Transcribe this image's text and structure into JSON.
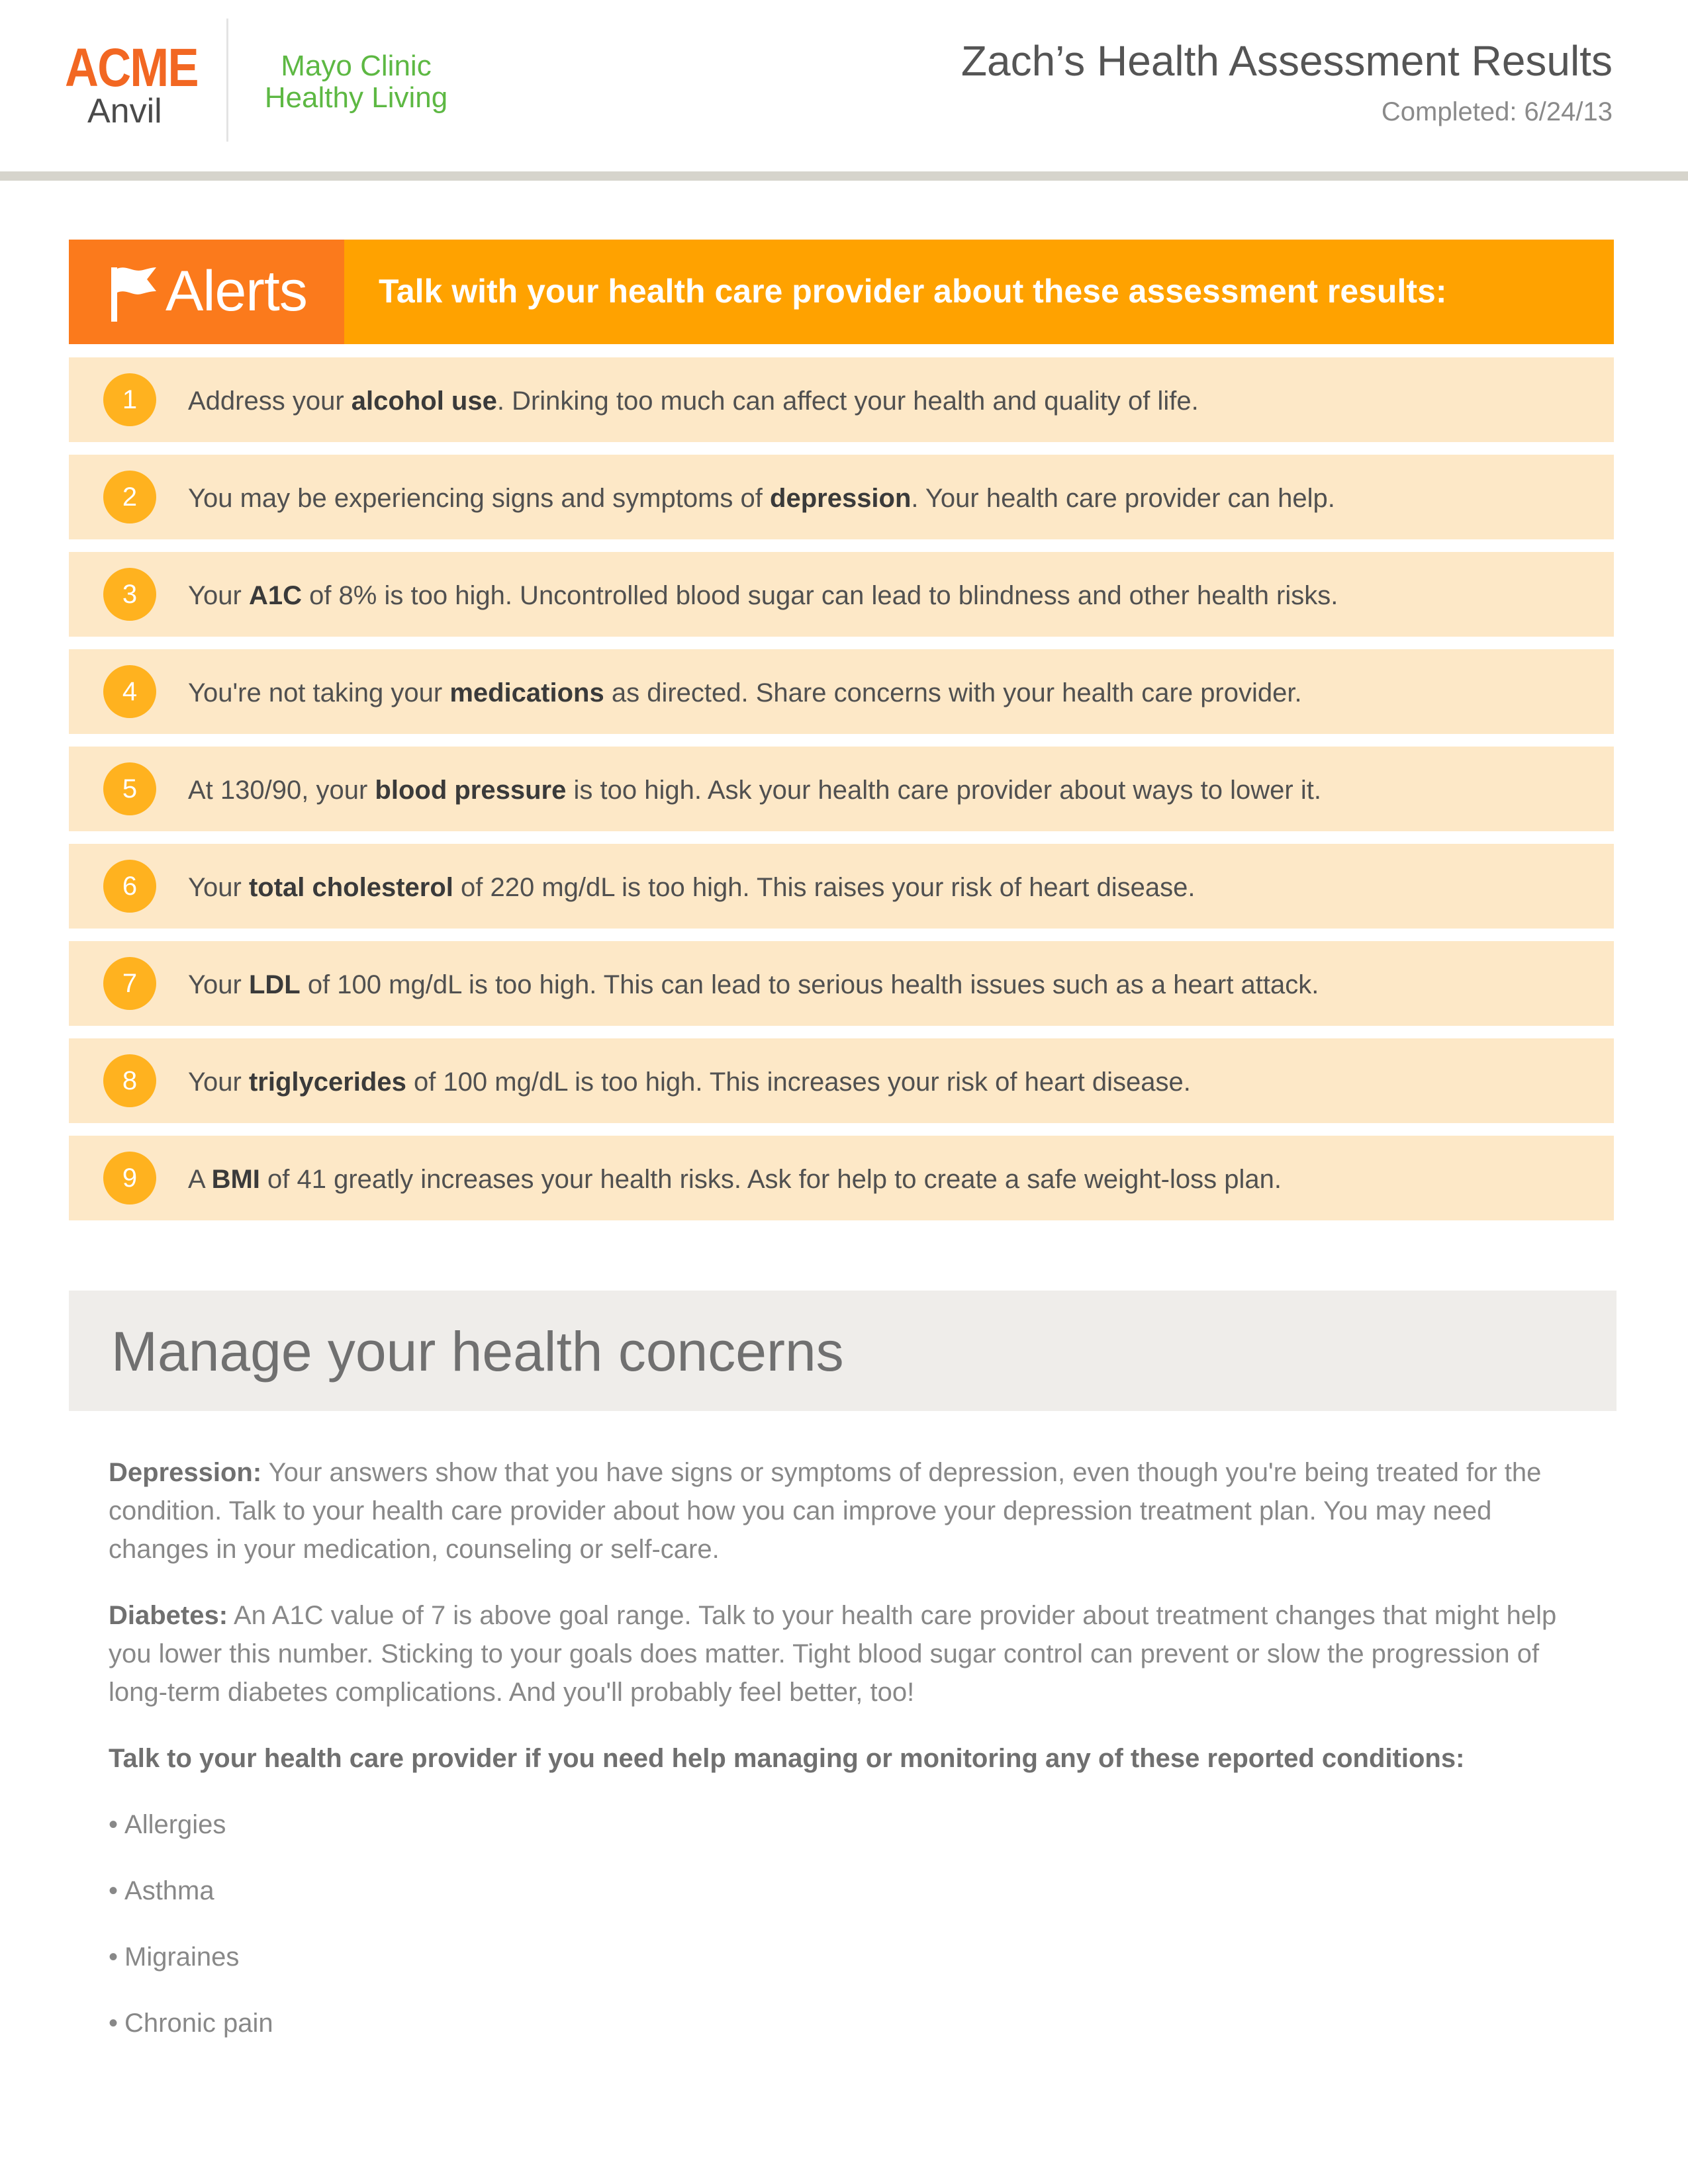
{
  "header": {
    "logo_line1": "ACME",
    "logo_line2": "Anvil",
    "partner_line1": "Mayo Clinic",
    "partner_line2": "Healthy Living",
    "title": "Zach’s Health Assessment Results",
    "completed": "Completed: 6/24/13"
  },
  "alerts": {
    "label": "Alerts",
    "icon": "flag-icon",
    "subtitle": "Talk with your health care provider about these assessment results:",
    "items": [
      {
        "number": "1",
        "pre": "Address your ",
        "bold": "alcohol use",
        "post": ". Drinking too much can affect your health and quality of life."
      },
      {
        "number": "2",
        "pre": "You may be experiencing signs and symptoms of ",
        "bold": "depression",
        "post": ". Your health care provider can help."
      },
      {
        "number": "3",
        "pre": "Your ",
        "bold": "A1C",
        "post": " of 8% is too high. Uncontrolled blood sugar can lead to blindness and other health risks."
      },
      {
        "number": "4",
        "pre": "You're not taking your ",
        "bold": "medications",
        "post": " as directed. Share concerns with your health care provider."
      },
      {
        "number": "5",
        "pre": "At 130/90, your ",
        "bold": "blood pressure",
        "post": " is too high. Ask your health care provider about ways to lower it."
      },
      {
        "number": "6",
        "pre": "Your ",
        "bold": "total cholesterol",
        "post": " of 220 mg/dL is too high. This raises your risk of heart disease."
      },
      {
        "number": "7",
        "pre": "Your ",
        "bold": "LDL",
        "post": " of 100 mg/dL is too high. This can lead to serious health issues such as a heart attack."
      },
      {
        "number": "8",
        "pre": "Your ",
        "bold": "triglycerides",
        "post": " of 100 mg/dL is too high. This increases your risk of heart disease."
      },
      {
        "number": "9",
        "pre": "A ",
        "bold": "BMI",
        "post": " of 41 greatly increases your health risks. Ask for help to create a safe weight-loss plan."
      }
    ]
  },
  "manage": {
    "title": "Manage your health concerns",
    "depression_label": "Depression:",
    "depression_text": " Your answers show that you have signs or symptoms of depression, even though you're being treated for the condition. Talk to your health care provider about how you can improve your depression treatment plan. You may need changes in your medication, counseling or self-care.",
    "diabetes_label": "Diabetes:",
    "diabetes_text": " An A1C value of 7 is above goal range. Talk to your health care provider about treatment changes that might help you lower this number. Sticking to your goals does matter. Tight blood sugar control can prevent or slow the progression of long-term diabetes complications. And you'll probably feel better, too!",
    "conditions_heading": "Talk to your health care provider if you need help managing or monitoring any of these reported conditions:",
    "conditions": [
      "Allergies",
      "Asthma",
      "Migraines",
      "Chronic pain"
    ]
  },
  "colors": {
    "brand_orange": "#f26722",
    "partner_green": "#5db843",
    "alert_bar": "#ffa200",
    "alert_tab": "#fb7a1c",
    "alert_row": "#fde8c7",
    "alert_badge": "#ffb21f",
    "manage_bar": "#efedea"
  }
}
